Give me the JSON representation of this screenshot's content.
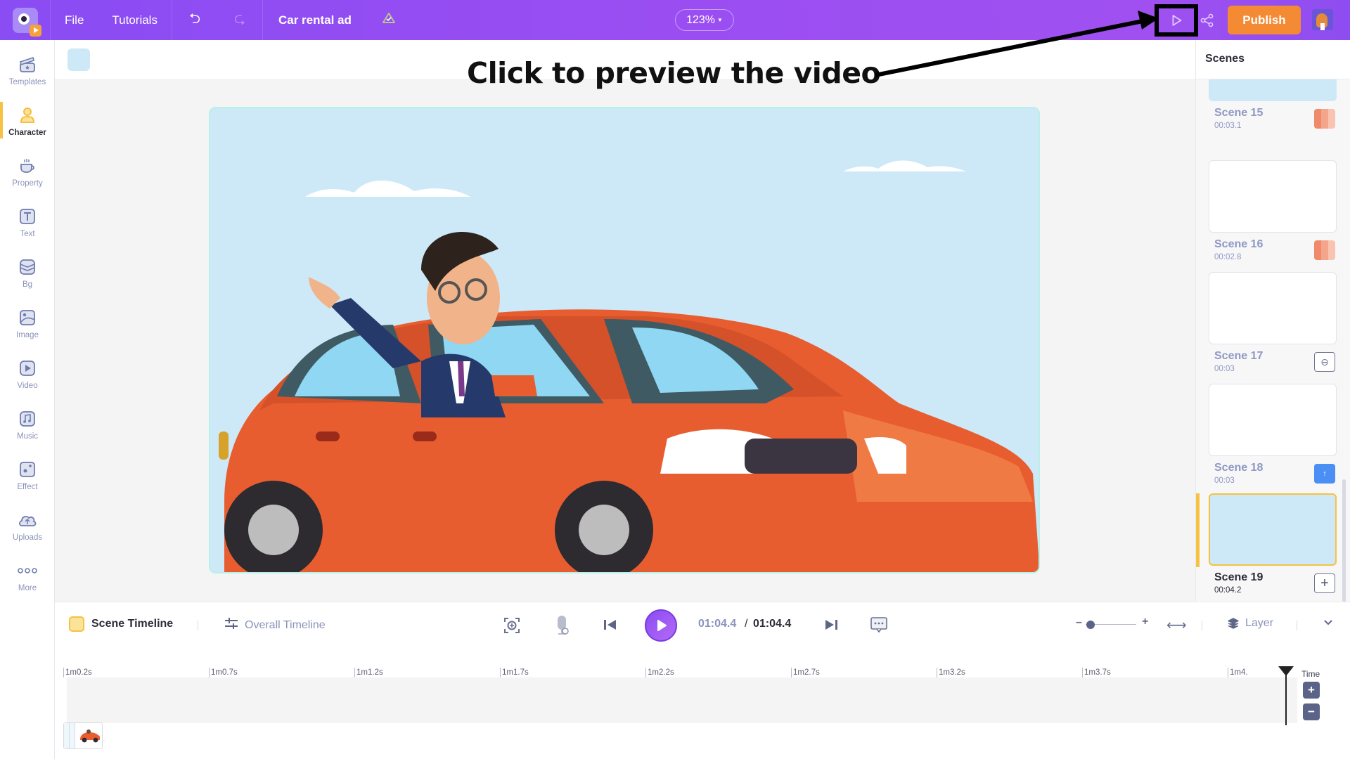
{
  "topbar": {
    "menu": [
      "File",
      "Tutorials"
    ],
    "project_title": "Car rental ad",
    "zoom_level": "123%",
    "publish_label": "Publish",
    "icons": {
      "logo": "app-logo",
      "undo": "undo-icon",
      "redo": "redo-icon",
      "cloud": "cloud-saved-icon",
      "preview": "play-outline-icon",
      "share": "share-icon",
      "avatar": "user-avatar"
    }
  },
  "annotation": {
    "text": "Click to preview the video"
  },
  "sidebar": {
    "items": [
      {
        "label": "Templates",
        "icon": "templates-icon"
      },
      {
        "label": "Character",
        "icon": "character-icon",
        "active": true
      },
      {
        "label": "Property",
        "icon": "property-icon"
      },
      {
        "label": "Text",
        "icon": "text-icon"
      },
      {
        "label": "Bg",
        "icon": "background-icon"
      },
      {
        "label": "Image",
        "icon": "image-icon"
      },
      {
        "label": "Video",
        "icon": "video-icon"
      },
      {
        "label": "Music",
        "icon": "music-icon"
      },
      {
        "label": "Effect",
        "icon": "effect-icon"
      },
      {
        "label": "Uploads",
        "icon": "upload-cloud-icon"
      },
      {
        "label": "More",
        "icon": "more-dots-icon"
      }
    ]
  },
  "canvas_toolbar": {
    "color": "#cde9f8"
  },
  "scenes": {
    "title": "Scenes",
    "items": [
      {
        "name": "Scene 15",
        "duration": "00:03.1",
        "badge": "transition",
        "thumb": "sky"
      },
      {
        "name": "Scene 16",
        "duration": "00:02.8",
        "badge": "transition",
        "thumb": "blank"
      },
      {
        "name": "Scene 17",
        "duration": "00:03",
        "badge": "link",
        "thumb": "blank"
      },
      {
        "name": "Scene 18",
        "duration": "00:03",
        "badge": "upload",
        "thumb": "blank"
      },
      {
        "name": "Scene 19",
        "duration": "00:04.2",
        "badge": "add",
        "thumb": "sky",
        "active": true
      }
    ]
  },
  "controls": {
    "scene_timeline_label": "Scene Timeline",
    "overall_timeline_label": "Overall Timeline",
    "current_time": "01:04.4",
    "separator": "/",
    "total_time": "01:04.4",
    "layer_label": "Layer",
    "zoom_slider_value": 0.1
  },
  "timeline": {
    "ticks": [
      "1m0.2s",
      "1m0.7s",
      "1m1.2s",
      "1m1.7s",
      "1m2.2s",
      "1m2.7s",
      "1m3.2s",
      "1m3.7s",
      "1m4."
    ],
    "time_label": "Time",
    "zoom_in": "+",
    "zoom_out": "−"
  }
}
